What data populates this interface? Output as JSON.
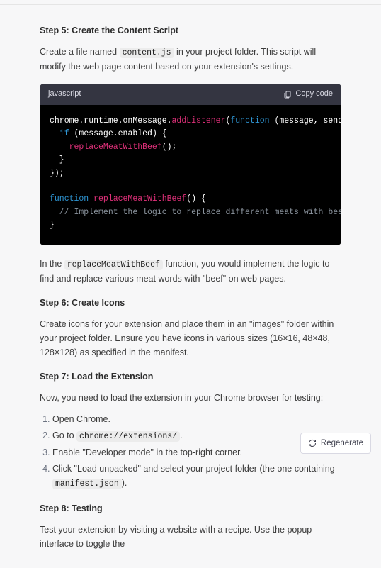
{
  "step5": {
    "title": "Step 5: Create the Content Script",
    "intro_pre": "Create a file named ",
    "intro_code": "content.js",
    "intro_post": " in your project folder. This script will modify the web page content based on your extension's settings."
  },
  "codeblock": {
    "lang": "javascript",
    "copy_label": "Copy code",
    "t": {
      "l1a": "chrome.runtime.onMessage.",
      "l1b": "addListener",
      "l1c": "(",
      "l1d": "function",
      "l1e": " (message, sender, sendResponse) {",
      "l2a": "  ",
      "l2b": "if",
      "l2c": " (message.enabled) {",
      "l3a": "    ",
      "l3b": "replaceMeatWithBeef",
      "l3c": "();",
      "l4": "  }",
      "l5": "});",
      "blank": "",
      "l6a": "function",
      "l6b": " ",
      "l6c": "replaceMeatWithBeef",
      "l6d": "() {",
      "l7": "  // Implement the logic to replace different meats with beef here",
      "l8": "}"
    }
  },
  "after_code": {
    "pre": "In the ",
    "code": "replaceMeatWithBeef",
    "post": " function, you would implement the logic to find and replace various meat words with \"beef\" on web pages."
  },
  "step6": {
    "title": "Step 6: Create Icons",
    "body": "Create icons for your extension and place them in an \"images\" folder within your project folder. Ensure you have icons in various sizes (16×16, 48×48, 128×128) as specified in the manifest."
  },
  "step7": {
    "title": "Step 7: Load the Extension",
    "intro": "Now, you need to load the extension in your Chrome browser for testing:",
    "items": {
      "i1": "Open Chrome.",
      "i2_pre": "Go to ",
      "i2_code": "chrome://extensions/",
      "i2_post": ".",
      "i3": "Enable \"Developer mode\" in the top-right corner.",
      "i4_pre": "Click \"Load unpacked\" and select your project folder (the one containing ",
      "i4_code": "manifest.json",
      "i4_post": ")."
    }
  },
  "step8": {
    "title": "Step 8: Testing",
    "body": "Test your extension by visiting a website with a recipe. Use the popup interface to toggle the"
  },
  "regenerate": "Regenerate"
}
